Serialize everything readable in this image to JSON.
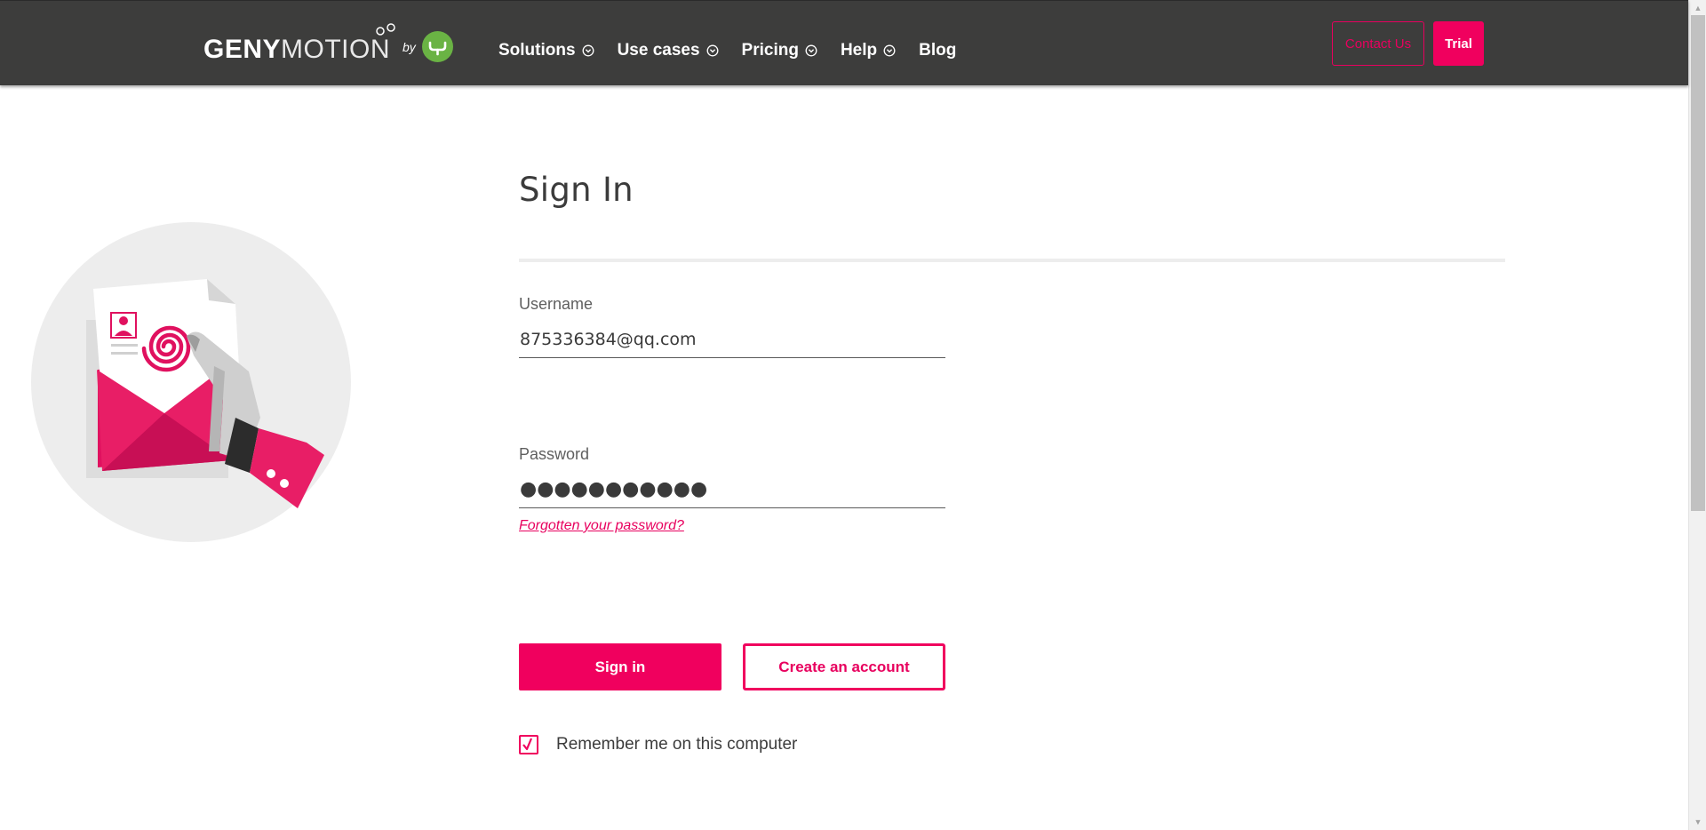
{
  "header": {
    "logo": {
      "word_bold": "GENY",
      "word_thin": "MOTION",
      "by": "by"
    },
    "nav": [
      {
        "label": "Solutions",
        "has_dropdown": true
      },
      {
        "label": "Use cases",
        "has_dropdown": true
      },
      {
        "label": "Pricing",
        "has_dropdown": true
      },
      {
        "label": "Help",
        "has_dropdown": true
      },
      {
        "label": "Blog",
        "has_dropdown": false
      }
    ],
    "contact_label": "Contact Us",
    "trial_label": "Trial"
  },
  "form": {
    "title": "Sign In",
    "username": {
      "label": "Username",
      "value": "875336384@qq.com"
    },
    "password": {
      "label": "Password",
      "value": "●●●●●●●●●●●"
    },
    "forgot_label": "Forgotten your password?",
    "signin_label": "Sign in",
    "create_label": "Create an account",
    "remember": {
      "label": "Remember me on this computer",
      "checked": true
    }
  },
  "colors": {
    "accent": "#f0005e",
    "header_bg": "#3d3d3c",
    "logo_badge": "#6ab344"
  },
  "icons": {
    "nav_dropdown": "chevron-down-icon",
    "checkbox": "checkmark-icon",
    "illustration": "envelope-fingerprint-illustration"
  }
}
